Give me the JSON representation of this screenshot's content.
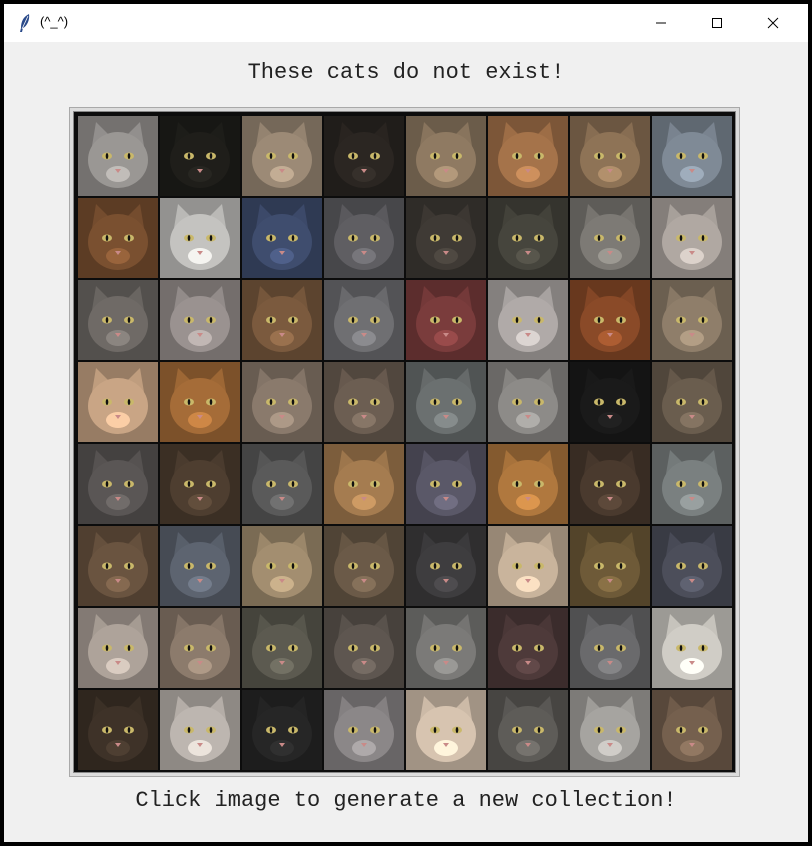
{
  "window": {
    "title": "(^_^)",
    "icon": "feather-icon",
    "controls": [
      "minimize-icon",
      "maximize-icon",
      "close-icon"
    ]
  },
  "heading": "These cats do not exist!",
  "footer": "Click image to generate a new collection!",
  "grid": {
    "rows": 8,
    "cols": 8,
    "cells": [
      [
        "#9a9794",
        "#1f1e1a",
        "#9c8a76",
        "#2b2622",
        "#8f7a62",
        "#a5734a",
        "#8e7356",
        "#7f8a96"
      ],
      [
        "#7a5030",
        "#c4c3c0",
        "#3f4d6e",
        "#5f5e62",
        "#3f3a35",
        "#46453d",
        "#7d7a75",
        "#b0a8a2"
      ],
      [
        "#6f6a66",
        "#9a9290",
        "#7b5a3e",
        "#6f6f72",
        "#7a3c3c",
        "#b0aaa8",
        "#8a4a28",
        "#8f7e6a"
      ],
      [
        "#c9a585",
        "#a56c38",
        "#8a7a6c",
        "#6c5e52",
        "#6b7070",
        "#8d8b88",
        "#1a1a1a",
        "#6a5d4e"
      ],
      [
        "#5a5655",
        "#4e3e30",
        "#5a5a5a",
        "#a57c50",
        "#5a5868",
        "#b0783e",
        "#4a3a2e",
        "#7a8080"
      ],
      [
        "#6a5440",
        "#5d6470",
        "#a38e70",
        "#6b5a48",
        "#3e3d3f",
        "#c9b49c",
        "#6e5a38",
        "#4c4e5a"
      ],
      [
        "#aea39a",
        "#8c7b6c",
        "#5c5a50",
        "#5e5650",
        "#7b7a78",
        "#4e3a3a",
        "#6a6a6c",
        "#d0cdc6"
      ],
      [
        "#3e3228",
        "#bdb6b0",
        "#262626",
        "#8b8788",
        "#d7c4b0",
        "#5e5c58",
        "#a6a4a0",
        "#75604e"
      ]
    ]
  }
}
